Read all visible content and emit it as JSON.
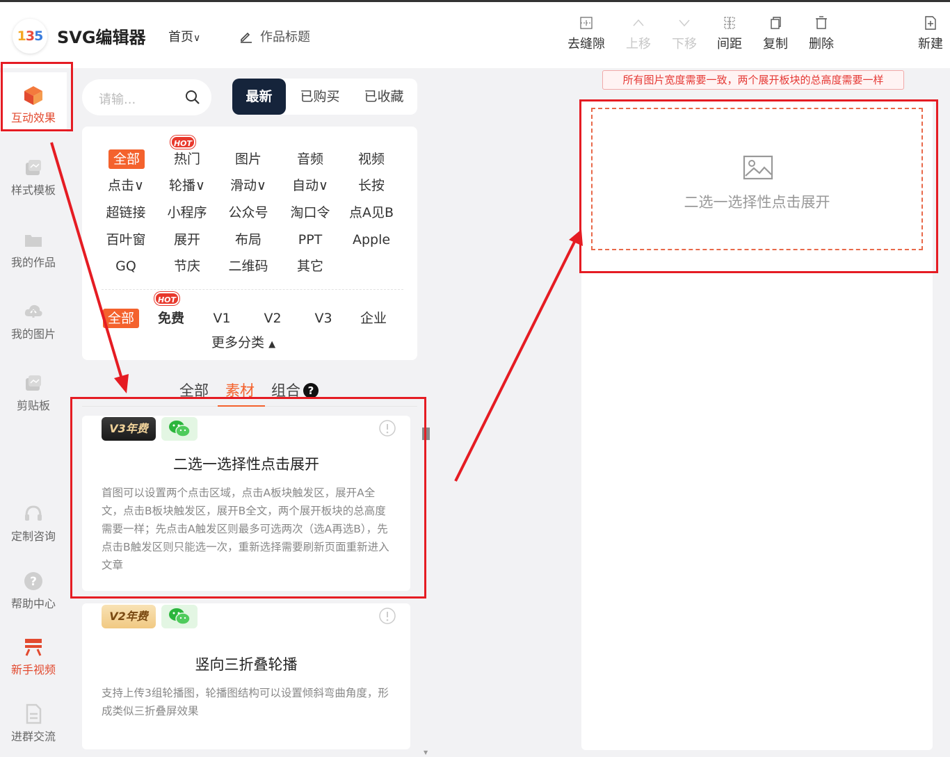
{
  "header": {
    "logo_text_1": "1",
    "logo_text_2": "3",
    "logo_text_3": "5",
    "app_title": "SVG编辑器",
    "nav_home": "首页",
    "work_title": "作品标题",
    "tools": [
      {
        "label": "去缝隙",
        "icon": "gap-icon",
        "disabled": false
      },
      {
        "label": "上移",
        "icon": "chevron-up-icon",
        "disabled": true
      },
      {
        "label": "下移",
        "icon": "chevron-down-icon",
        "disabled": true
      },
      {
        "label": "间距",
        "icon": "spacing-icon",
        "disabled": false
      },
      {
        "label": "复制",
        "icon": "copy-icon",
        "disabled": false
      },
      {
        "label": "删除",
        "icon": "trash-icon",
        "disabled": false
      },
      {
        "label": "新建",
        "icon": "new-file-icon",
        "disabled": false
      }
    ]
  },
  "leftnav": {
    "items": [
      {
        "label": "互动效果",
        "icon": "cube-icon",
        "active": true
      },
      {
        "label": "样式模板",
        "icon": "template-icon"
      },
      {
        "label": "我的作品",
        "icon": "folder-icon"
      },
      {
        "label": "我的图片",
        "icon": "cloud-upload-icon"
      },
      {
        "label": "剪贴板",
        "icon": "clipboard-icon"
      },
      {
        "label": "定制咨询",
        "icon": "headset-icon"
      },
      {
        "label": "帮助中心",
        "icon": "help-icon"
      },
      {
        "label": "新手视频",
        "icon": "video-icon",
        "highlight": true
      },
      {
        "label": "进群交流",
        "icon": "document-icon"
      }
    ]
  },
  "search": {
    "placeholder": "请输..."
  },
  "tabs": [
    {
      "label": "最新",
      "active": true
    },
    {
      "label": "已购买"
    },
    {
      "label": "已收藏"
    }
  ],
  "categories": {
    "row1": [
      "全部",
      "热门",
      "图片",
      "音频",
      "视频"
    ],
    "row2": [
      "点击∨",
      "轮播∨",
      "滑动∨",
      "自动∨",
      "长按"
    ],
    "row3": [
      "超链接",
      "小程序",
      "公众号",
      "淘口令",
      "点A见B"
    ],
    "row4": [
      "百叶窗",
      "展开",
      "布局",
      "PPT",
      "Apple"
    ],
    "row5": [
      "GQ",
      "节庆",
      "二维码",
      "其它"
    ],
    "hot_label": "HOT",
    "price": [
      "全部",
      "免费",
      "V1",
      "V2",
      "V3",
      "企业"
    ],
    "more": "更多分类"
  },
  "subtabs": [
    {
      "label": "全部"
    },
    {
      "label": "素材",
      "active": true
    },
    {
      "label": "组合"
    }
  ],
  "subtabs_help": "?",
  "cards": [
    {
      "version_badge": "V3年费",
      "title": "二选一选择性点击展开",
      "description": "首图可以设置两个点击区域，点击A板块触发区，展开A全文，点击B板块触发区，展开B全文，两个展开板块的总高度需要一样；先点击A触发区则最多可选两次（选A再选B），先点击B触发区则只能选一次，重新选择需要刷新页面重新进入文章"
    },
    {
      "version_badge": "V2年费",
      "title": "竖向三折叠轮播",
      "description": "支持上传3组轮播图，轮播图结构可以设置倾斜弯曲角度，形成类似三折叠屏效果"
    }
  ],
  "canvas": {
    "notice": "所有图片宽度需要一致，两个展开板块的总高度需要一样",
    "placeholder_text": "二选一选择性点击展开"
  },
  "colors": {
    "accent": "#f4622d",
    "annotation": "#e51c23",
    "dark_tab": "#15243b"
  }
}
